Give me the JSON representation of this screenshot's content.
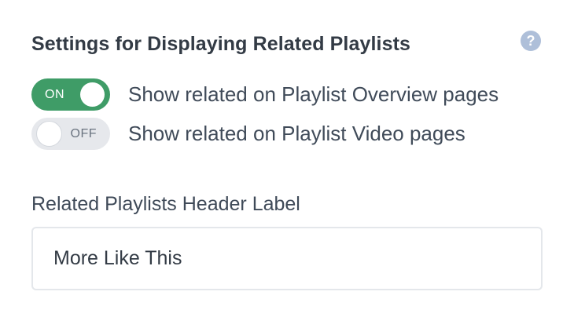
{
  "section": {
    "title": "Settings for Displaying Related Playlists",
    "help_glyph": "?"
  },
  "toggles": [
    {
      "state_label": "ON",
      "enabled": true,
      "text": "Show related on Playlist Overview pages"
    },
    {
      "state_label": "OFF",
      "enabled": false,
      "text": "Show related on Playlist Video pages"
    }
  ],
  "header_label_field": {
    "label": "Related Playlists Header Label",
    "value": "More Like This"
  },
  "colors": {
    "toggle_on": "#3f9c67",
    "toggle_off": "#e6e8ec",
    "help_icon": "#aebfd9"
  }
}
